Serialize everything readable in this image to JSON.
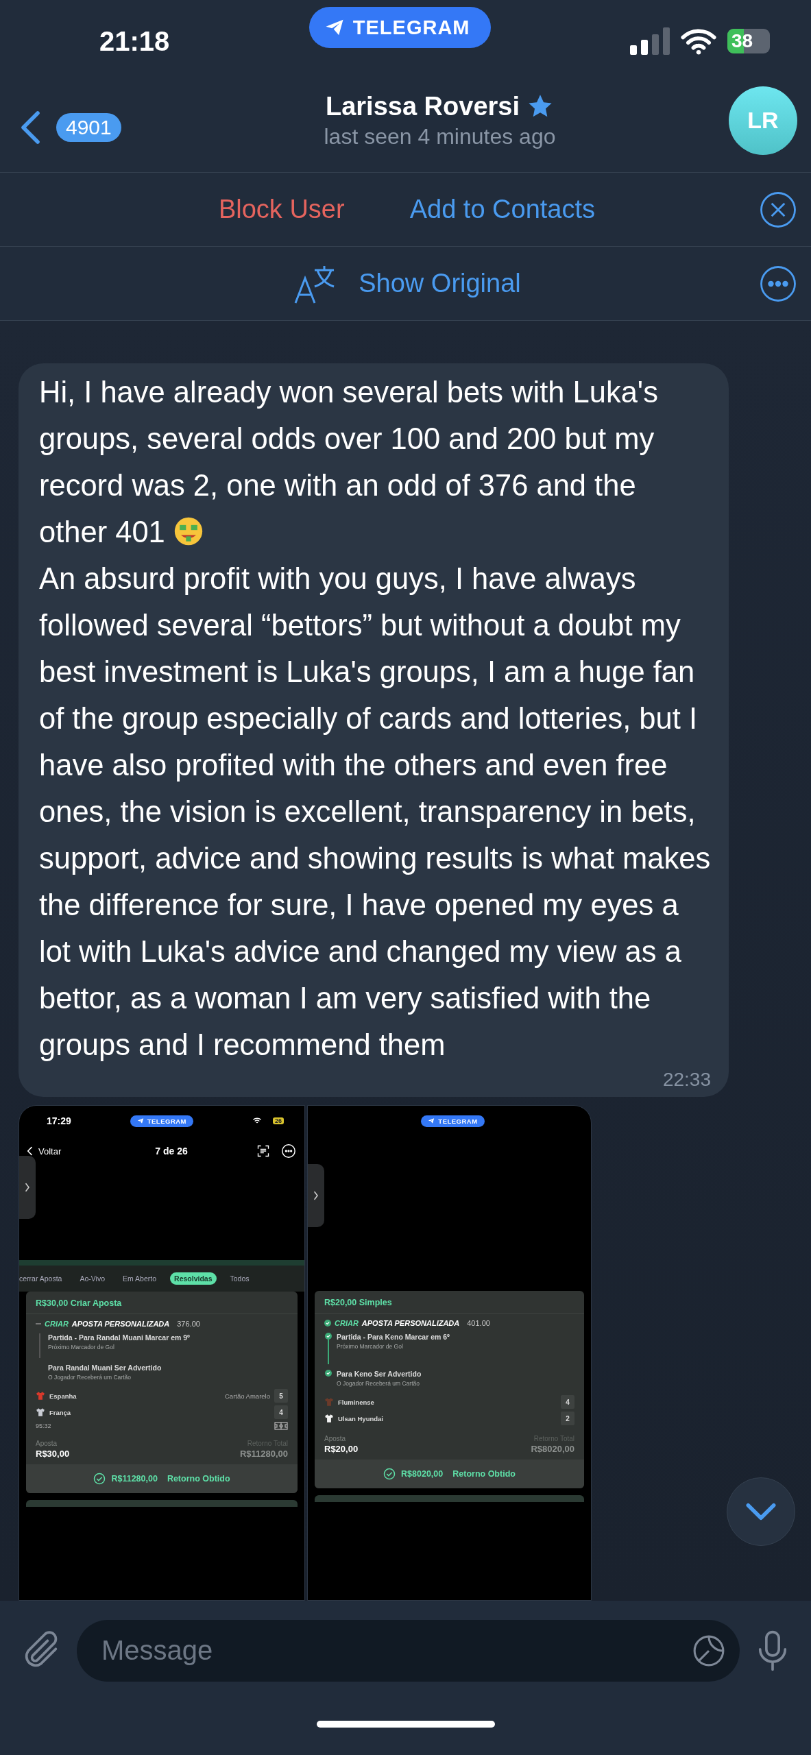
{
  "status_bar": {
    "time": "21:18",
    "pill": "TELEGRAM",
    "battery": "38"
  },
  "header": {
    "back_count": "4901",
    "name": "Larissa Roversi",
    "status": "last seen 4 minutes ago",
    "avatar": "LR"
  },
  "action_bar": {
    "block": "Block User",
    "add": "Add to Contacts"
  },
  "translate_bar": {
    "label": "Show Original"
  },
  "message": {
    "paragraphs": [
      "Hi, I have already won several bets with Luka's groups, several odds over 100 and 200 but my record was 2, one with an odd of 376 and the other 401",
      "An absurd profit with you guys, I have always followed several “bettors” but without a doubt my best investment is Luka's groups, I am a huge fan of the group especially of cards and lotteries, but I have also profited with the others and even free ones, the vision is excellent, transparency in bets, support, advice and showing results is what makes the difference for sure, I have opened my eyes a lot with Luka's advice and changed my view as a bettor, as a woman I am very satisfied with the groups and I recommend them"
    ],
    "time": "22:33"
  },
  "attachments": [
    {
      "pill": "TELEGRAM",
      "status_time": "17:29",
      "battery": "26",
      "nav": {
        "back": "Voltar",
        "title": "7 de 26"
      },
      "tabs": [
        {
          "label": "cerrar Aposta",
          "selected": false
        },
        {
          "label": "Ao-Vivo",
          "selected": false
        },
        {
          "label": "Em Aberto",
          "selected": false
        },
        {
          "label": "Resolvidas",
          "selected": true
        },
        {
          "label": "Todos",
          "selected": false
        }
      ],
      "bet_title": "R$30,00 Criar Aposta",
      "builder": {
        "kind": "dash",
        "prefix": "CRIAR",
        "title": "APOSTA PERSONALIZADA",
        "odds": "376.00"
      },
      "selections": [
        {
          "title": "Partida - Para Randal Muani Marcar em 9º",
          "subtitle": "Próximo Marcador de Gol"
        },
        {
          "title": "Para Randal Muani Ser Advertido",
          "subtitle": "O Jogador Receberá um Cartão"
        }
      ],
      "teams": [
        {
          "name": "Espanha",
          "color": "#d8392b",
          "stat": "Cartão Amarelo",
          "count": "5"
        },
        {
          "name": "França",
          "color": "#c9ccd4",
          "count": "4"
        }
      ],
      "clock": "95:32",
      "stake_label": "Aposta",
      "stake": "R$30,00",
      "return_label": "Retorno Total",
      "return": "R$11280,00",
      "result": {
        "amount": "R$11280,00",
        "label": "Retorno Obtido"
      }
    },
    {
      "pill": "TELEGRAM",
      "bet_title": "R$20,00 Simples",
      "builder": {
        "kind": "check",
        "prefix": "CRIAR",
        "title": "APOSTA PERSONALIZADA",
        "odds": "401.00"
      },
      "selections": [
        {
          "title": "Partida - Para Keno Marcar em 6º",
          "subtitle": "Próximo Marcador de Gol"
        },
        {
          "title": "Para Keno Ser Advertido",
          "subtitle": "O Jogador Receberá um Cartão"
        }
      ],
      "teams": [
        {
          "name": "Fluminense",
          "color": "#6b3a2a",
          "count": "4"
        },
        {
          "name": "Ulsan Hyundai",
          "color": "#f2f2f2",
          "count": "2"
        }
      ],
      "stake_label": "Aposta",
      "stake": "R$20,00",
      "return_label": "Retorno Total",
      "return": "R$8020,00",
      "result": {
        "amount": "R$8020,00",
        "label": "Retorno Obtido"
      }
    }
  ],
  "composer": {
    "placeholder": "Message"
  }
}
